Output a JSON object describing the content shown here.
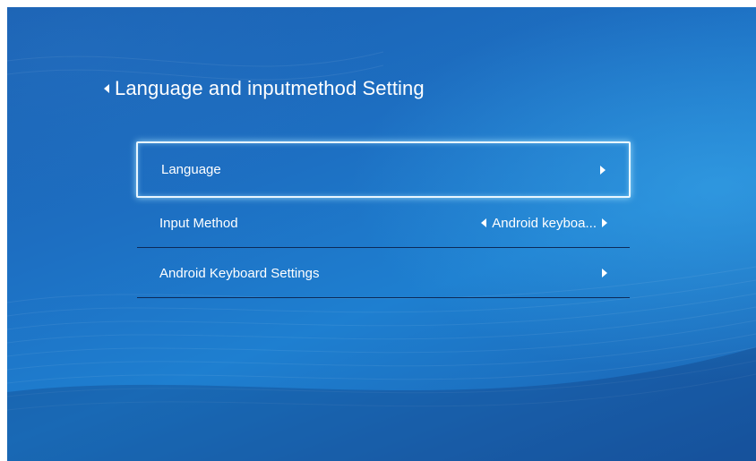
{
  "header": {
    "title": "Language and inputmethod Setting"
  },
  "menu": {
    "items": [
      {
        "label": "Language"
      },
      {
        "label": "Input Method",
        "value": "Android keyboa..."
      },
      {
        "label": "Android Keyboard Settings"
      }
    ]
  },
  "icons": {
    "back": "back-arrow-icon",
    "right": "chevron-right-icon",
    "left": "chevron-left-icon"
  },
  "colors": {
    "background": "#1e7fd0",
    "focus_border": "#e8f6ff",
    "divider": "#0c2a58",
    "text": "#ffffff"
  }
}
